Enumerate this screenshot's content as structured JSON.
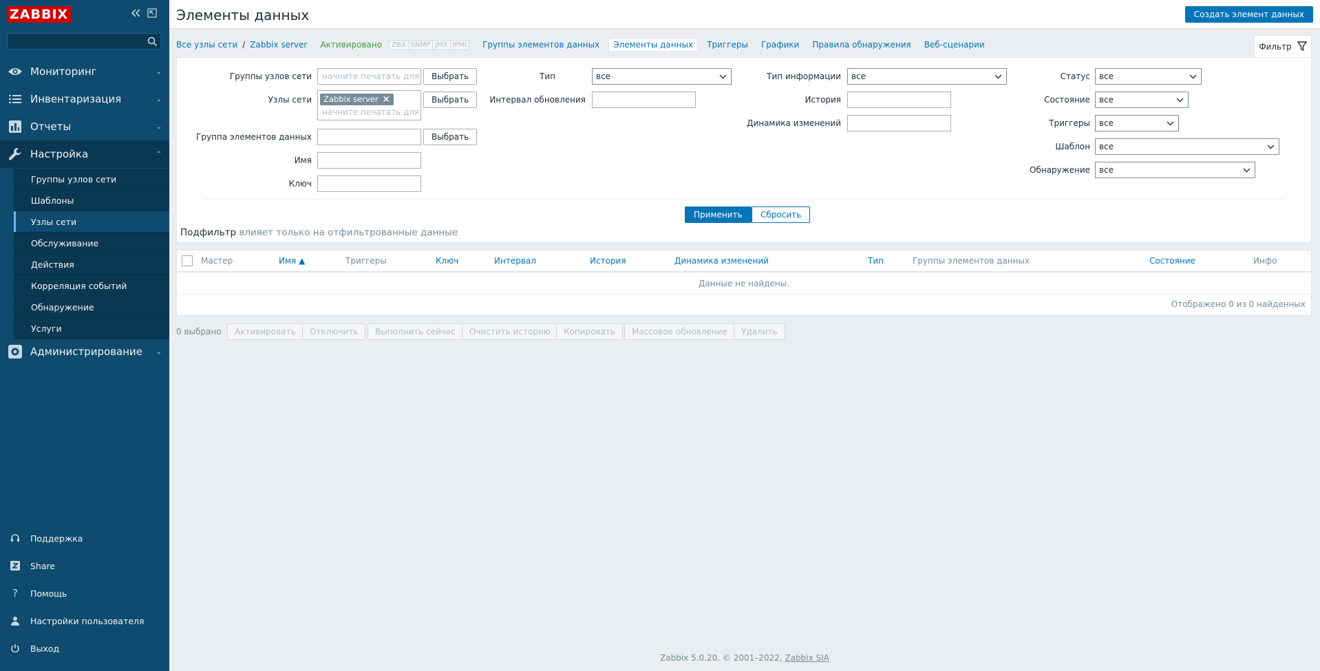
{
  "sidebar": {
    "logo": "ZABBIX",
    "collapse_icon": "collapse-icon",
    "kiosk_icon": "kiosk-icon",
    "search_placeholder": "",
    "menu": [
      {
        "label": "Мониторинг",
        "icon": "eye-icon"
      },
      {
        "label": "Инвентаризация",
        "icon": "list-icon"
      },
      {
        "label": "Отчеты",
        "icon": "bar-chart-icon"
      },
      {
        "label": "Настройка",
        "icon": "wrench-icon"
      },
      {
        "label": "Администрирование",
        "icon": "gear-icon"
      }
    ],
    "submenu": [
      "Группы узлов сети",
      "Шаблоны",
      "Узлы сети",
      "Обслуживание",
      "Действия",
      "Корреляция событий",
      "Обнаружение",
      "Услуги"
    ],
    "bottom": [
      {
        "label": "Поддержка",
        "icon": "headset-icon"
      },
      {
        "label": "Share",
        "icon": "share-icon"
      },
      {
        "label": "Помощь",
        "icon": "help-icon"
      },
      {
        "label": "Настройки пользователя",
        "icon": "user-icon"
      },
      {
        "label": "Выход",
        "icon": "power-icon"
      }
    ]
  },
  "header": {
    "title": "Элементы данных",
    "create_button": "Создать элемент данных"
  },
  "breadcrumb": {
    "all_hosts": "Все узлы сети",
    "separator": "/",
    "host": "Zabbix server",
    "status": "Активировано",
    "protocols": [
      "ZBX",
      "SNMP",
      "JMX",
      "IPMI"
    ],
    "tabs": [
      "Группы элементов данных",
      "Элементы данных",
      "Триггеры",
      "Графики",
      "Правила обнаружения",
      "Веб-сценарии"
    ]
  },
  "filter": {
    "tab_label": "Фильтр",
    "labels": {
      "host_groups": "Группы узлов сети",
      "hosts": "Узлы сети",
      "item_group": "Группа элементов данных",
      "name": "Имя",
      "key": "Ключ",
      "type": "Тип",
      "update_interval": "Интервал обновления",
      "info_type": "Тип информации",
      "history": "История",
      "trends": "Динамика изменений",
      "status": "Статус",
      "state": "Состояние",
      "triggers": "Триггеры",
      "template": "Шаблон",
      "discovery": "Обнаружение"
    },
    "placeholder": "начните печатать для по",
    "select_button": "Выбрать",
    "host_chip": "Zabbix server",
    "select_value": "все",
    "apply": "Применить",
    "reset": "Сбросить",
    "subfilter_title": "Подфильтр",
    "subfilter_note": "влияет только на отфильтрованные данные"
  },
  "table": {
    "columns": [
      {
        "label": "Мастер",
        "link": false
      },
      {
        "label": "Имя ▲",
        "link": true
      },
      {
        "label": "Триггеры",
        "link": false
      },
      {
        "label": "Ключ",
        "link": true
      },
      {
        "label": "Интервал",
        "link": true
      },
      {
        "label": "История",
        "link": true
      },
      {
        "label": "Динамика изменений",
        "link": true
      },
      {
        "label": "Тип",
        "link": true
      },
      {
        "label": "Группы элементов данных",
        "link": false
      },
      {
        "label": "Состояние",
        "link": true
      },
      {
        "label": "Инфо",
        "link": false
      }
    ],
    "no_data": "Данные не найдены.",
    "paging": "Отображено 0 из 0 найденных"
  },
  "actions": {
    "selected": "0 выбрано",
    "buttons": [
      "Активировать",
      "Отключить",
      "Выполнить сейчас",
      "Очистить историю",
      "Копировать",
      "Массовое обновление",
      "Удалить"
    ]
  },
  "footer": {
    "text": "Zabbix 5.0.20. © 2001–2022,",
    "link": "Zabbix SIA"
  },
  "colors": {
    "sidebar_bg": "#0e4b6e",
    "accent": "#0275b8",
    "enabled_green": "#429e47",
    "logo_red": "#d40000"
  }
}
